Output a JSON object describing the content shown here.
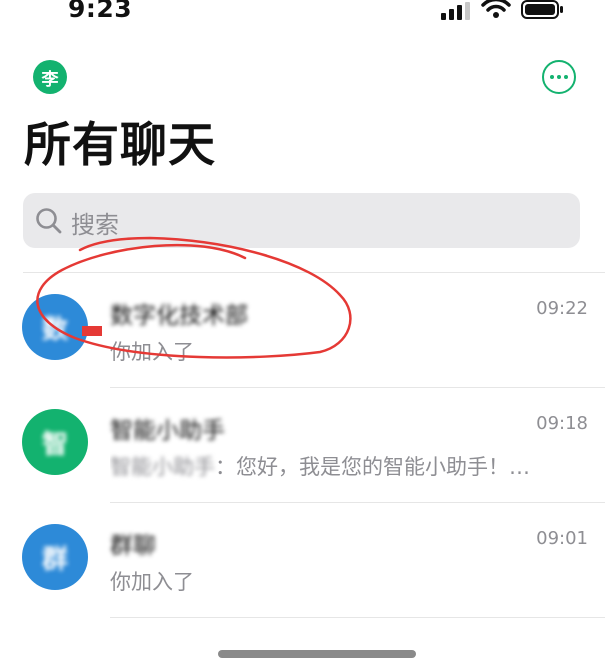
{
  "status_bar": {
    "time": "9:23"
  },
  "header": {
    "user_avatar_text": "李",
    "title": "所有聊天"
  },
  "search": {
    "placeholder": "搜索"
  },
  "chats": [
    {
      "avatar_text": "数",
      "avatar_color": "#2d8ad8",
      "name": "数字化技术部",
      "time": "09:22",
      "message": "你加入了"
    },
    {
      "avatar_text": "智",
      "avatar_color": "#13b26f",
      "name": "智能小助手",
      "message_prefix": "智能小助手",
      "time": "09:18",
      "message": "：您好，我是您的智能小助手！…"
    },
    {
      "avatar_text": "群",
      "avatar_color": "#2d8ad8",
      "name": "群聊",
      "time": "09:01",
      "message": "你加入了"
    }
  ],
  "colors": {
    "accent": "#13b26f",
    "annotation": "#e53935"
  }
}
